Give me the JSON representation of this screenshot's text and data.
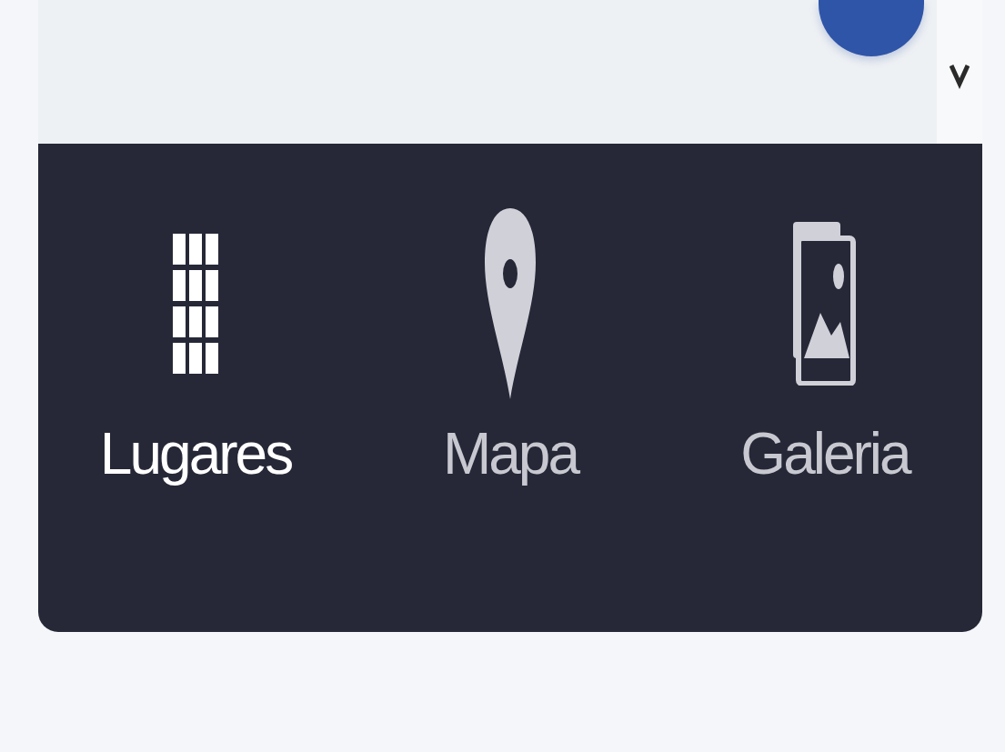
{
  "nav": {
    "items": [
      {
        "kind": "places",
        "label": "Lugares",
        "selected": true
      },
      {
        "kind": "map",
        "label": "Mapa",
        "selected": false
      },
      {
        "kind": "gallery",
        "label": "Galeria",
        "selected": false
      }
    ]
  }
}
